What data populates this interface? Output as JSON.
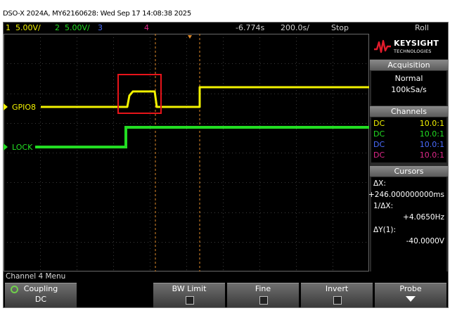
{
  "titlebar": "DSO-X 2024A, MY62160628: Wed Sep 17 14:08:38 2025",
  "topbar": {
    "ch1_num": "1",
    "ch1_scale": "5.00V/",
    "ch2_num": "2",
    "ch2_scale": "5.00V/",
    "ch3_num": "3",
    "ch4_num": "4",
    "time_offset": "-6.774s",
    "time_scale": "200.0s/",
    "run_state": "Stop",
    "mode": "Roll"
  },
  "traces": {
    "ch1_label": "GPIO8",
    "ch2_label": "LOCK",
    "ch1_color": "#f2f200",
    "ch2_color": "#22dd22"
  },
  "panel": {
    "brand": "KEYSIGHT",
    "brand_sub": "TECHNOLOGIES",
    "acq_header": "Acquisition",
    "acq_mode": "Normal",
    "acq_rate": "100kSa/s",
    "ch_header": "Channels",
    "channels": [
      {
        "coupling": "DC",
        "probe": "10.0:1",
        "color": "#f2f200"
      },
      {
        "coupling": "DC",
        "probe": "10.0:1",
        "color": "#22dd22"
      },
      {
        "coupling": "DC",
        "probe": "10.0:1",
        "color": "#4a6cff"
      },
      {
        "coupling": "DC",
        "probe": "10.0:1",
        "color": "#e0288a"
      }
    ],
    "cursor_header": "Cursors",
    "dx_label": "ΔX:",
    "dx_value": "+246.000000000ms",
    "inv_dx_label": "1/ΔX:",
    "inv_dx_value": "+4.0650Hz",
    "dy_label": "ΔY(1):",
    "dy_value": "-40.0000V"
  },
  "menu_label": "Channel 4 Menu",
  "softkeys": {
    "coupling_label": "Coupling",
    "coupling_value": "DC",
    "bw_limit": "BW Limit",
    "fine": "Fine",
    "invert": "Invert",
    "probe": "Probe"
  }
}
